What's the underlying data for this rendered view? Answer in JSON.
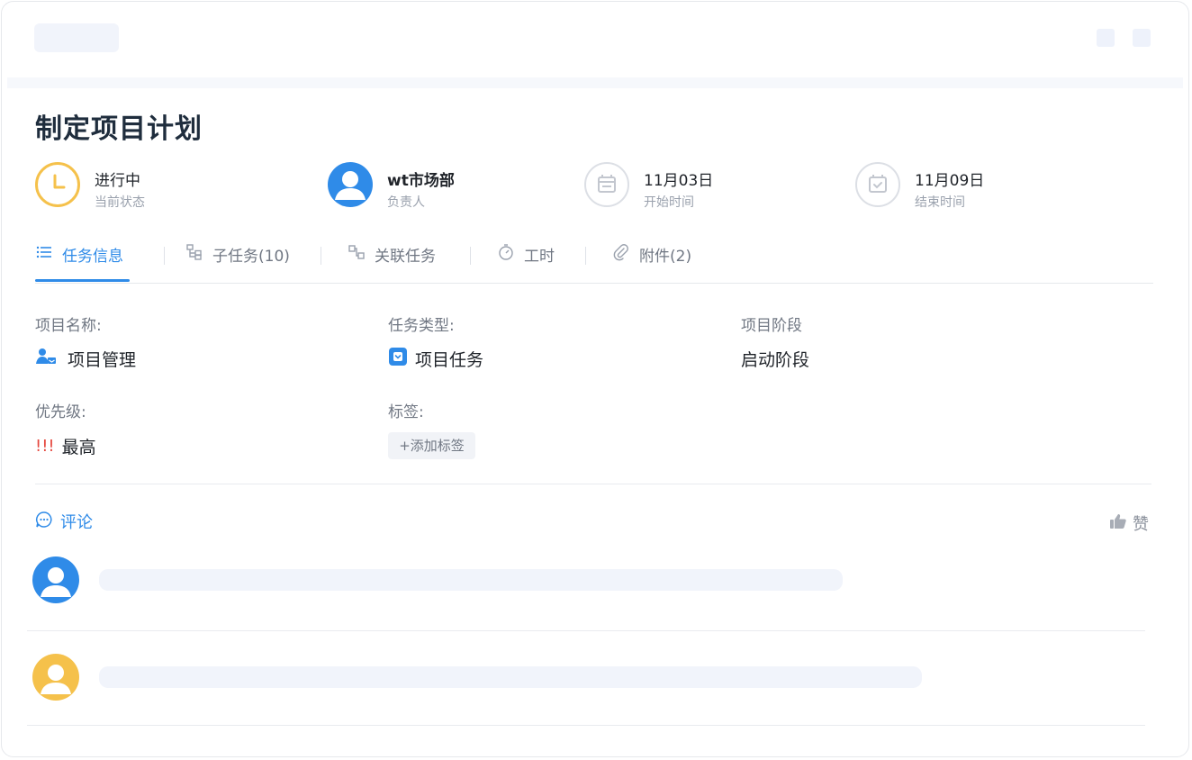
{
  "task": {
    "title": "制定项目计划"
  },
  "meta": {
    "status": {
      "value": "进行中",
      "label": "当前状态"
    },
    "owner": {
      "value": "wt市场部",
      "label": "负责人"
    },
    "start": {
      "value": "11月03日",
      "label": "开始时间"
    },
    "end": {
      "value": "11月09日",
      "label": "结束时间"
    }
  },
  "tabs": [
    {
      "label": "任务信息",
      "icon": "list-icon"
    },
    {
      "label": "子任务(10)",
      "icon": "subtask-icon"
    },
    {
      "label": "关联任务",
      "icon": "link-task-icon"
    },
    {
      "label": "工时",
      "icon": "timer-icon"
    },
    {
      "label": "附件(2)",
      "icon": "paperclip-icon"
    }
  ],
  "fields": {
    "project_name": {
      "label": "项目名称:",
      "value": "项目管理"
    },
    "task_type": {
      "label": "任务类型:",
      "value": "项目任务"
    },
    "project_stage": {
      "label": "项目阶段",
      "value": "启动阶段"
    },
    "priority": {
      "label": "优先级:",
      "mark": "!!!",
      "value": "最高"
    },
    "tags": {
      "label": "标签:",
      "add_button": "+添加标签"
    }
  },
  "comments": {
    "title": "评论",
    "like": "赞"
  },
  "colors": {
    "accent": "#2f8be8",
    "status": "#f5c14b",
    "priority": "#e5483f",
    "avatar_yellow": "#f5c14b"
  }
}
